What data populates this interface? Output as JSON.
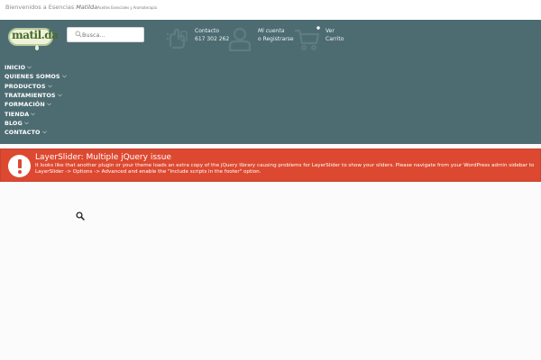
{
  "topbar": {
    "welcome": "Bienvenidos a Esencias ",
    "brand": "Matilda",
    "tagline": "Aceites Esenciales y Aromaterapia"
  },
  "logo": {
    "text": "matil.da"
  },
  "search": {
    "placeholder": "Busca..."
  },
  "contact": {
    "line1": "Contacto",
    "line2": "617 302 262"
  },
  "account": {
    "line1": "Mi cuenta",
    "line2": "o Registrarse"
  },
  "cart": {
    "line1": "Ver",
    "line2": "Carrito"
  },
  "menu": {
    "items": [
      {
        "label": "INICIO"
      },
      {
        "label": "QUIENES SOMOS"
      },
      {
        "label": "PRODUCTOS"
      },
      {
        "label": "TRATAMIENTOS"
      },
      {
        "label": "FORMACIÓN"
      },
      {
        "label": "TIENDA"
      },
      {
        "label": "BLOG"
      },
      {
        "label": "CONTACTO"
      }
    ]
  },
  "alert": {
    "title": "LayerSlider: Multiple jQuery issue",
    "message": "It looks like that another plugin or your theme loads an extra copy of the jQuery library causing problems for LayerSlider to show your sliders. Please navigate from your WordPress admin sidebar to LayerSlider -> Options -> Advanced and enable the \"Include scripts in the footer\" option."
  },
  "colors": {
    "header_bg": "#4d6c72",
    "alert_bg": "#dd4930",
    "icon_stroke": "#5f7c82"
  },
  "icons": {
    "search": "search-icon",
    "contact": "phone-hand-icon",
    "account": "user-icon",
    "cart": "cart-icon",
    "alert": "exclamation-icon",
    "menu_chevron": "chevron-down-icon"
  }
}
